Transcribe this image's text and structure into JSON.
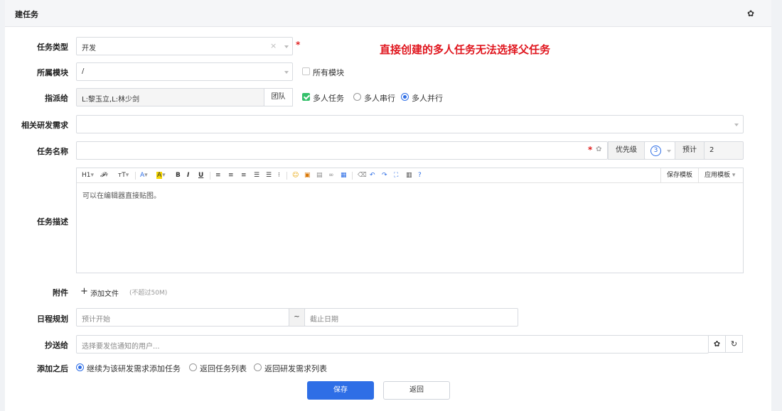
{
  "header": {
    "title": "建任务",
    "settings_icon": "gear-icon"
  },
  "note": "直接创建的多人任务无法选择父任务",
  "form": {
    "task_type": {
      "label": "任务类型",
      "value": "开发",
      "clear": "×"
    },
    "module": {
      "label": "所属模块",
      "value": "/",
      "all_modules_label": "所有模块",
      "all_modules_checked": false
    },
    "assign": {
      "label": "指派给",
      "value": "L:黎玉立,L:林少剑",
      "team_button": "团队",
      "multi_task_label": "多人任务",
      "multi_task_checked": true,
      "serial_label": "多人串行",
      "parallel_label": "多人并行",
      "selected_mode": "parallel"
    },
    "story": {
      "label": "相关研发需求",
      "value": ""
    },
    "name": {
      "label": "任务名称",
      "value": "",
      "priority_label": "优先级",
      "priority_value": "3",
      "estimate_label": "预计",
      "estimate_value": "2"
    },
    "description": {
      "label": "任务描述",
      "placeholder": "可以在编辑器直接贴图。",
      "toolbar": {
        "heading": "H1",
        "font": "𝓕",
        "size": "тT",
        "font_color": "A",
        "bg_color": "A",
        "bold": "B",
        "italic": "I",
        "underline": "U",
        "save_template": "保存模板",
        "apply_template": "应用模板"
      }
    },
    "attachment": {
      "label": "附件",
      "add_label": "添加文件",
      "limit": "(不超过50M)"
    },
    "schedule": {
      "label": "日程规划",
      "start_placeholder": "预计开始",
      "separator": "~",
      "end_placeholder": "截止日期"
    },
    "mailto": {
      "label": "抄送给",
      "placeholder": "选择要发信通知的用户..."
    },
    "after": {
      "label": "添加之后",
      "options": [
        "继续为该研发需求添加任务",
        "返回任务列表",
        "返回研发需求列表"
      ],
      "selected": 0
    }
  },
  "actions": {
    "save": "保存",
    "back": "返回"
  },
  "colors": {
    "primary": "#2e6ee6",
    "required": "#e02020",
    "note": "#e0161e",
    "check": "#34c06a"
  }
}
